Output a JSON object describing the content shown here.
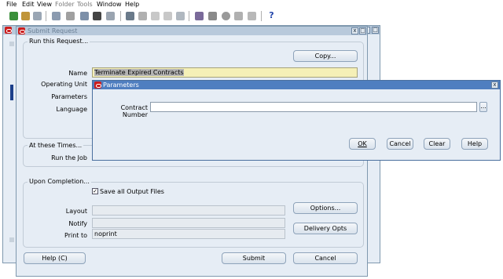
{
  "menu": [
    "File",
    "Edit",
    "View",
    "Folder",
    "Tools",
    "Window",
    "Help"
  ],
  "toolbar_icons": [
    "new-icon",
    "open-icon",
    "save-icon",
    "print-icon",
    "close-form-icon",
    "cut-icon",
    "copy-icon",
    "paste-icon",
    "clear-icon",
    "edit-field-icon",
    "zoom-icon",
    "translate-icon",
    "attach-icon",
    "folder-icon",
    "help-icon"
  ],
  "back_window": {
    "title": "Submit Request"
  },
  "submit": {
    "title": "Submit Request",
    "run_group_title": "Run this Request...",
    "copy_button": "Copy...",
    "name_label": "Name",
    "name_value": "Terminate Expired Contracts",
    "operating_unit_label": "Operating Unit",
    "parameters_label": "Parameters",
    "language_label": "Language",
    "times_group_title": "At these Times...",
    "run_job_label": "Run the Job",
    "completion_group_title": "Upon Completion...",
    "save_output_label": "Save all Output Files",
    "layout_label": "Layout",
    "notify_label": "Notify",
    "print_to_label": "Print to",
    "print_to_value": "noprint",
    "options_button": "Options...",
    "delivery_button": "Delivery Opts",
    "help_button": "Help (C)",
    "submit_button": "Submit",
    "cancel_button": "Cancel"
  },
  "params": {
    "title": "Parameters",
    "contract_number_label": "Contract Number",
    "contract_number_value": "",
    "lov_button": "...",
    "ok_button": "OK",
    "cancel_button": "Cancel",
    "clear_button": "Clear",
    "help_button": "Help"
  },
  "colors": {
    "active_title": "#4f7ec0",
    "inactive_title": "#b8c9db",
    "window_bg": "#e6edf5",
    "required_field": "#f5f0b7",
    "oracle_red": "#cc1e1e"
  }
}
